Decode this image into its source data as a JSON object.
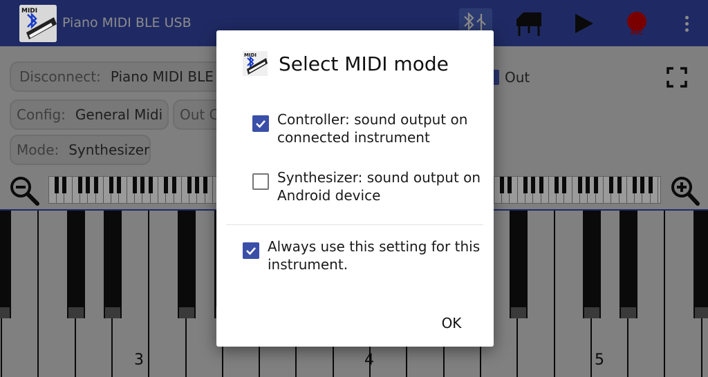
{
  "app": {
    "title": "Piano MIDI BLE USB",
    "rec_label": "REC"
  },
  "controls": {
    "disconnect_label": "Disconnect:",
    "disconnect_value": "Piano MIDI BLE USB",
    "config_label": "Config:",
    "config_value": "General Midi",
    "out_channel_label": "Out Ch",
    "mode_label": "Mode:",
    "mode_value": "Synthesizer",
    "out_label": "Out"
  },
  "keyboard": {
    "octave_labels": [
      "3",
      "4",
      "5"
    ]
  },
  "dialog": {
    "title": "Select MIDI mode",
    "options": [
      {
        "label": "Controller: sound output on connected instrument",
        "checked": true
      },
      {
        "label": "Synthesizer: sound output on Android device",
        "checked": false
      }
    ],
    "always_label": "Always use this setting for this instrument.",
    "always_checked": true,
    "ok_label": "OK"
  },
  "colors": {
    "app_bar": "#1f2a64",
    "accent": "#3a4fa8",
    "dim_background": "#7f7f7f",
    "rec_dot": "#7a0000"
  }
}
